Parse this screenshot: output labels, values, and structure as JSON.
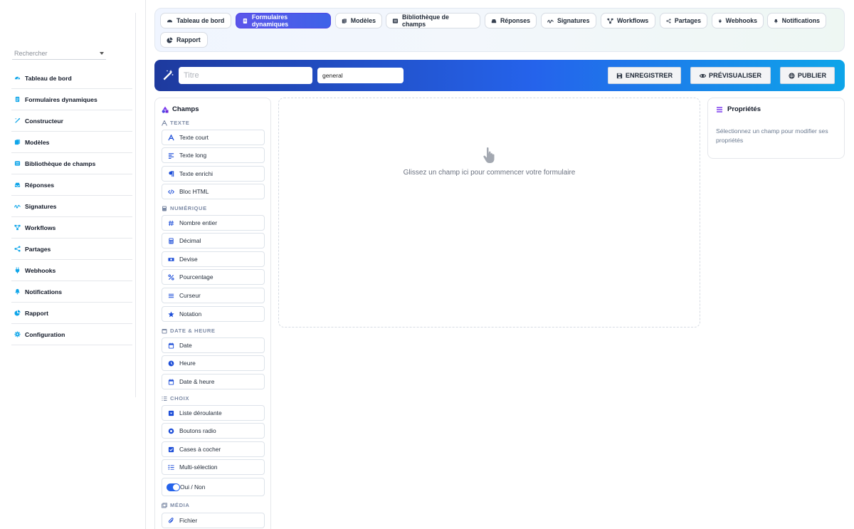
{
  "sidebar": {
    "search_placeholder": "Rechercher",
    "items": [
      {
        "label": "Tableau de bord",
        "icon": "dashboard-icon"
      },
      {
        "label": "Formulaires dynamiques",
        "icon": "form-icon"
      },
      {
        "label": "Constructeur",
        "icon": "wand-icon"
      },
      {
        "label": "Modèles",
        "icon": "templates-icon"
      },
      {
        "label": "Bibliothèque de champs",
        "icon": "library-icon"
      },
      {
        "label": "Réponses",
        "icon": "inbox-icon"
      },
      {
        "label": "Signatures",
        "icon": "signature-icon"
      },
      {
        "label": "Workflows",
        "icon": "workflow-icon"
      },
      {
        "label": "Partages",
        "icon": "share-icon"
      },
      {
        "label": "Webhooks",
        "icon": "plug-icon"
      },
      {
        "label": "Notifications",
        "icon": "bell-icon"
      },
      {
        "label": "Rapport",
        "icon": "pie-chart-icon"
      },
      {
        "label": "Configuration",
        "icon": "gear-icon"
      }
    ]
  },
  "tabs": [
    {
      "label": "Tableau de bord"
    },
    {
      "label": "Formulaires dynamiques",
      "active": true
    },
    {
      "label": "Modèles"
    },
    {
      "label": "Bibliothèque de champs"
    },
    {
      "label": "Réponses"
    },
    {
      "label": "Signatures"
    },
    {
      "label": "Workflows"
    },
    {
      "label": "Partages"
    },
    {
      "label": "Webhooks"
    },
    {
      "label": "Notifications"
    },
    {
      "label": "Rapport"
    }
  ],
  "toolbar": {
    "title_placeholder": "Titre",
    "category_value": "general",
    "save_label": "ENREGISTRER",
    "preview_label": "PRÉVISUALISER",
    "publish_label": "PUBLIER"
  },
  "fields": {
    "title": "Champs",
    "sections": [
      {
        "label": "TEXTE",
        "items": [
          "Texte court",
          "Texte long",
          "Texte enrichi",
          "Bloc HTML"
        ]
      },
      {
        "label": "NUMÉRIQUE",
        "items": [
          "Nombre entier",
          "Décimal",
          "Devise",
          "Pourcentage",
          "Curseur",
          "Notation"
        ]
      },
      {
        "label": "DATE & HEURE",
        "items": [
          "Date",
          "Heure",
          "Date & heure"
        ]
      },
      {
        "label": "CHOIX",
        "items": [
          "Liste déroulante",
          "Boutons radio",
          "Cases à cocher",
          "Multi-sélection",
          "Oui / Non"
        ]
      },
      {
        "label": "MÉDIA",
        "items": [
          "Fichier"
        ]
      }
    ]
  },
  "dropzone": {
    "text": "Glissez un champ ici pour commencer votre formulaire"
  },
  "properties": {
    "title": "Propriétés",
    "empty_text": "Sélectionnez un champ pour modifier ses propriétés"
  },
  "colors": {
    "accent": "#4f46e5",
    "icon_blue": "#0ea5e9",
    "toolbar_start": "#1e3a9e",
    "toolbar_end": "#0ea5e9"
  }
}
